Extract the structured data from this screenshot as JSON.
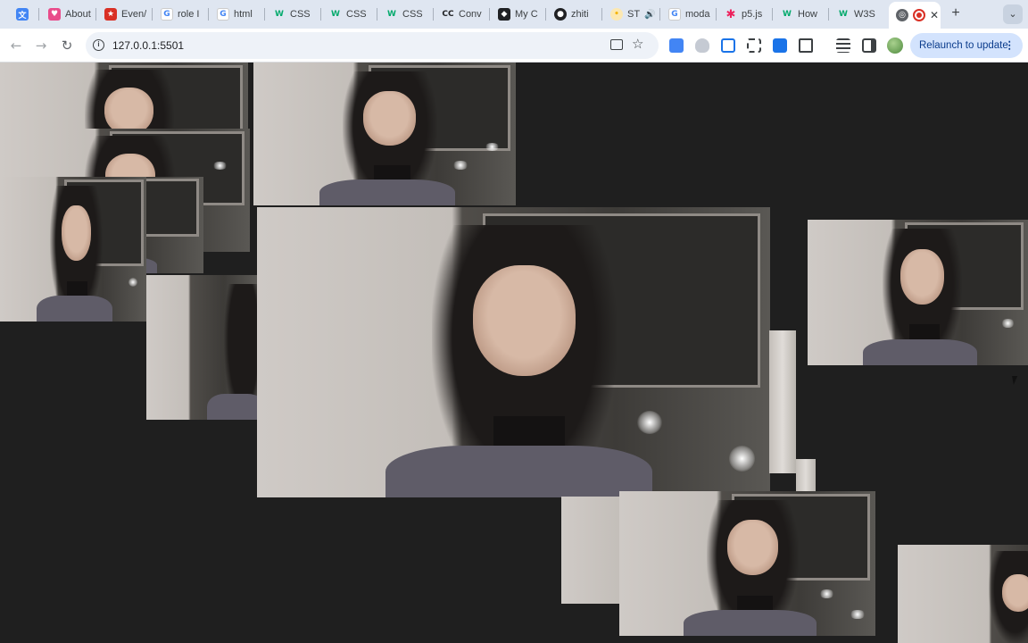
{
  "browser": {
    "tabs": [
      {
        "label": "",
        "icon": "translate-icon",
        "color": "#4285f4"
      },
      {
        "label": "About",
        "icon": "heart-icon",
        "color": "#e94b8a"
      },
      {
        "label": "Even/",
        "icon": "badge-icon",
        "color": "#d93025"
      },
      {
        "label": "role I",
        "icon": "google-icon",
        "color": "#4285f4"
      },
      {
        "label": "html",
        "icon": "google-icon",
        "color": "#4285f4"
      },
      {
        "label": "CSS",
        "icon": "w3-icon",
        "color": "#04aa6d"
      },
      {
        "label": "CSS",
        "icon": "w3-icon",
        "color": "#04aa6d"
      },
      {
        "label": "CSS",
        "icon": "w3-icon",
        "color": "#04aa6d"
      },
      {
        "label": "Conv",
        "icon": "cc-icon",
        "color": "#202124"
      },
      {
        "label": "My C",
        "icon": "codepen-icon",
        "color": "#202124"
      },
      {
        "label": "zhiti",
        "icon": "github-icon",
        "color": "#202124"
      },
      {
        "label": "ST",
        "icon": "dot-icon",
        "color": "#f4b400"
      },
      {
        "label": "moda",
        "icon": "google-icon",
        "color": "#4285f4"
      },
      {
        "label": "p5.js",
        "icon": "asterisk-icon",
        "color": "#ed225d"
      },
      {
        "label": "How",
        "icon": "w3-icon",
        "color": "#04aa6d"
      },
      {
        "label": "W3S",
        "icon": "w3-icon",
        "color": "#04aa6d"
      },
      {
        "label": "",
        "icon": "globe-icon",
        "color": "#5f6368",
        "active": true
      }
    ],
    "new_tab": "+",
    "tab_search": "⌄",
    "url": "127.0.0.1:5501",
    "relaunch_label": "Relaunch to update",
    "relaunch_menu": "⋮",
    "nav": {
      "back": "←",
      "forward": "→",
      "reload": "↻",
      "star": "☆"
    }
  },
  "page": {
    "background": "#1f1f1f",
    "content": "webcam-snapshot-collage"
  }
}
